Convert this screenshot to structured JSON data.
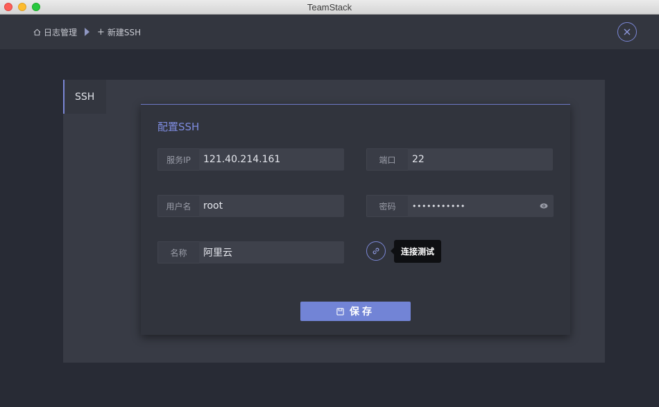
{
  "window": {
    "title": "TeamStack"
  },
  "breadcrumb": {
    "home_label": "日志管理",
    "current_label": "新建SSH"
  },
  "tabs": [
    {
      "label": "SSH",
      "active": true
    }
  ],
  "dialog": {
    "title": "配置SSH",
    "fields": {
      "ip": {
        "label": "服务IP",
        "value": "121.40.214.161"
      },
      "port": {
        "label": "端口",
        "value": "22"
      },
      "user": {
        "label": "用户名",
        "value": "root"
      },
      "password": {
        "label": "密码",
        "value": "•••••••••••"
      },
      "name": {
        "label": "名称",
        "value": "阿里云"
      }
    },
    "test_tooltip": "连接测试",
    "save_label": "保存"
  },
  "colors": {
    "accent": "#7284d6",
    "background": "#282b35",
    "header": "#33363f",
    "dialog": "#31343d"
  },
  "icons": {
    "home": "home-icon",
    "plus": "plus-icon",
    "close": "close-icon",
    "eye": "eye-icon",
    "link": "link-icon",
    "save": "save-icon"
  }
}
